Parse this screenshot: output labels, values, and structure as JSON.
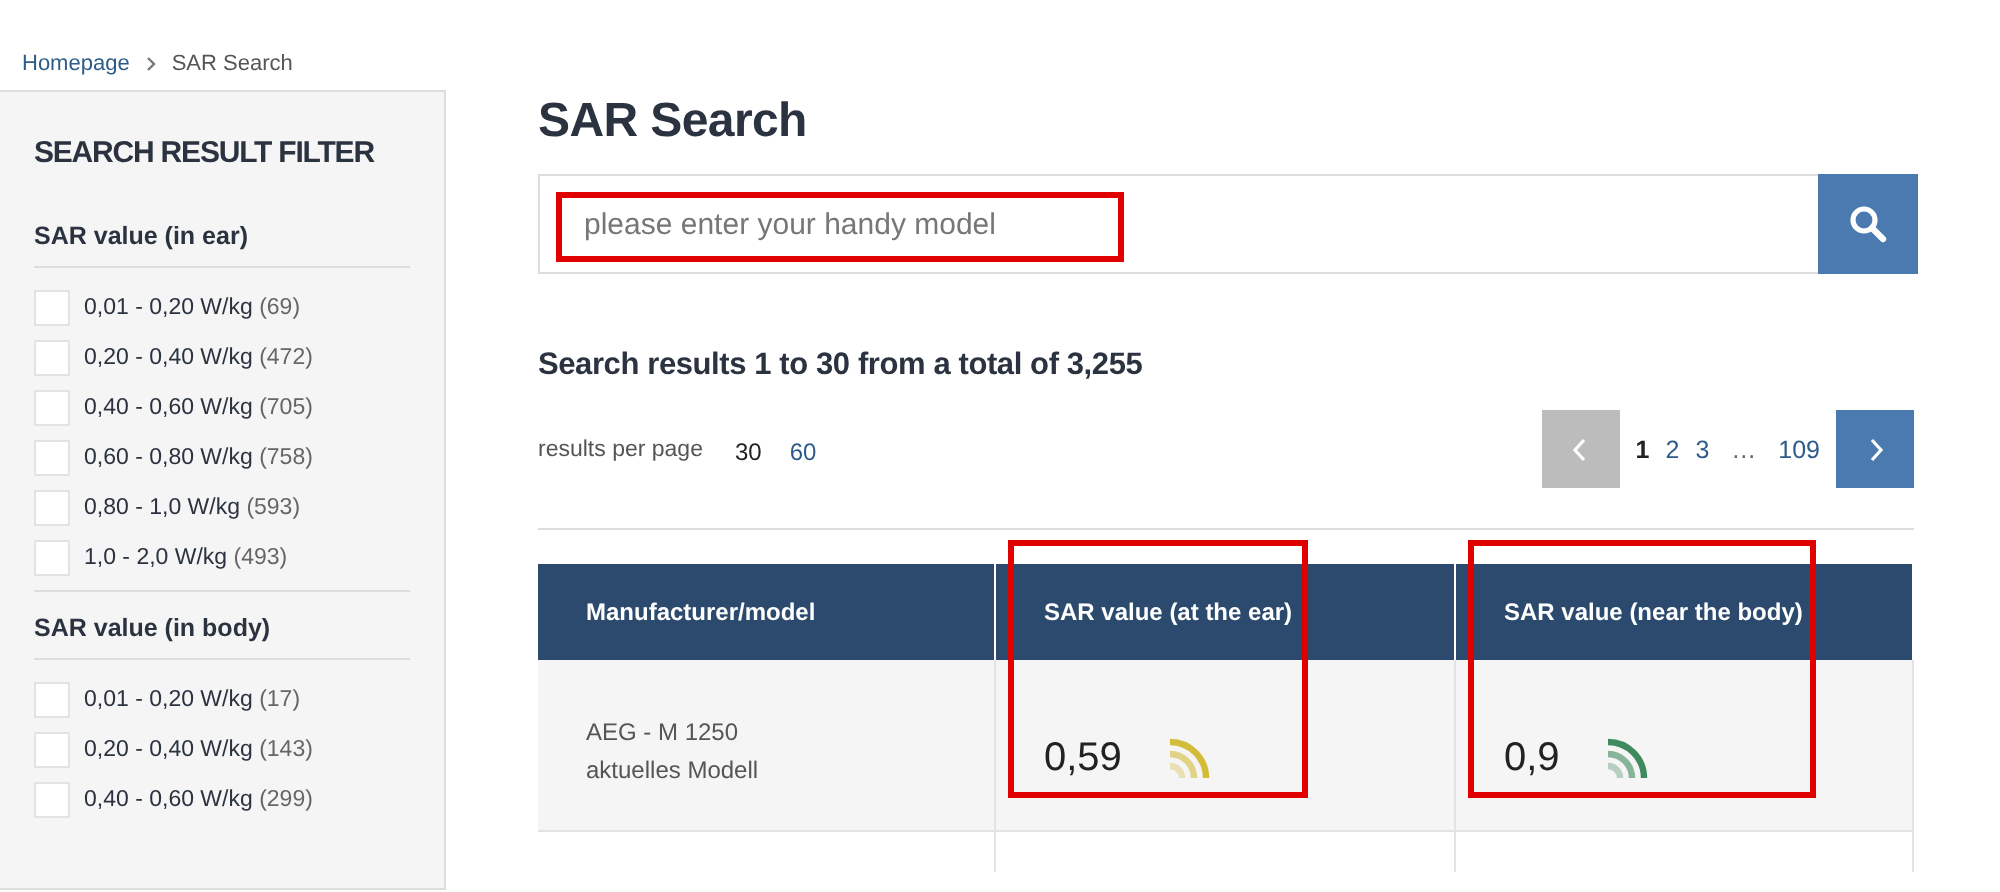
{
  "breadcrumb": [
    {
      "label": "Homepage",
      "kind": "link"
    },
    {
      "label": "SAR Search",
      "kind": "current"
    }
  ],
  "sidebar": {
    "title": "SEARCH RESULT FILTER",
    "groups": [
      {
        "title": "SAR value (in ear)",
        "options": [
          {
            "label": "0,01 - 0,20 W/kg",
            "count": "(69)",
            "checked": false
          },
          {
            "label": "0,20 - 0,40 W/kg",
            "count": "(472)",
            "checked": false
          },
          {
            "label": "0,40 - 0,60 W/kg",
            "count": "(705)",
            "checked": false
          },
          {
            "label": "0,60 - 0,80 W/kg",
            "count": "(758)",
            "checked": false
          },
          {
            "label": "0,80 - 1,0 W/kg",
            "count": "(593)",
            "checked": false
          },
          {
            "label": "1,0 - 2,0 W/kg",
            "count": "(493)",
            "checked": false
          }
        ]
      },
      {
        "title": "SAR value (in body)",
        "options": [
          {
            "label": "0,01 - 0,20 W/kg",
            "count": "(17)",
            "checked": false
          },
          {
            "label": "0,20 - 0,40 W/kg",
            "count": "(143)",
            "checked": false
          },
          {
            "label": "0,40 - 0,60 W/kg",
            "count": "(299)",
            "checked": false
          }
        ]
      }
    ]
  },
  "page_title": "SAR Search",
  "search": {
    "placeholder": "please enter your handy model",
    "highlighted": true
  },
  "results_heading": "Search results 1 to 30 from a total of 3,255",
  "per_page": {
    "label": "results per page",
    "options": [
      {
        "label": "30",
        "selected": true
      },
      {
        "label": "60",
        "selected": false
      }
    ]
  },
  "pagination": {
    "prev_disabled": true,
    "pages": [
      {
        "label": "1",
        "selected": true
      },
      {
        "label": "2",
        "selected": false
      },
      {
        "label": "3",
        "selected": false
      },
      {
        "label": "…",
        "kind": "gap"
      },
      {
        "label": "109",
        "selected": false
      }
    ]
  },
  "table": {
    "columns": [
      {
        "label": "Manufacturer/model",
        "highlighted": false
      },
      {
        "label": "SAR value (at the ear)",
        "highlighted": true
      },
      {
        "label": "SAR value (near the body)",
        "highlighted": true
      }
    ],
    "rows": [
      {
        "model": "AEG - M 1250",
        "note": "aktuelles Modell",
        "values": [
          {
            "value": "0,59",
            "color": "#d4bc3a"
          },
          {
            "value": "0,9",
            "color": "#3f8a5e"
          }
        ]
      }
    ]
  }
}
